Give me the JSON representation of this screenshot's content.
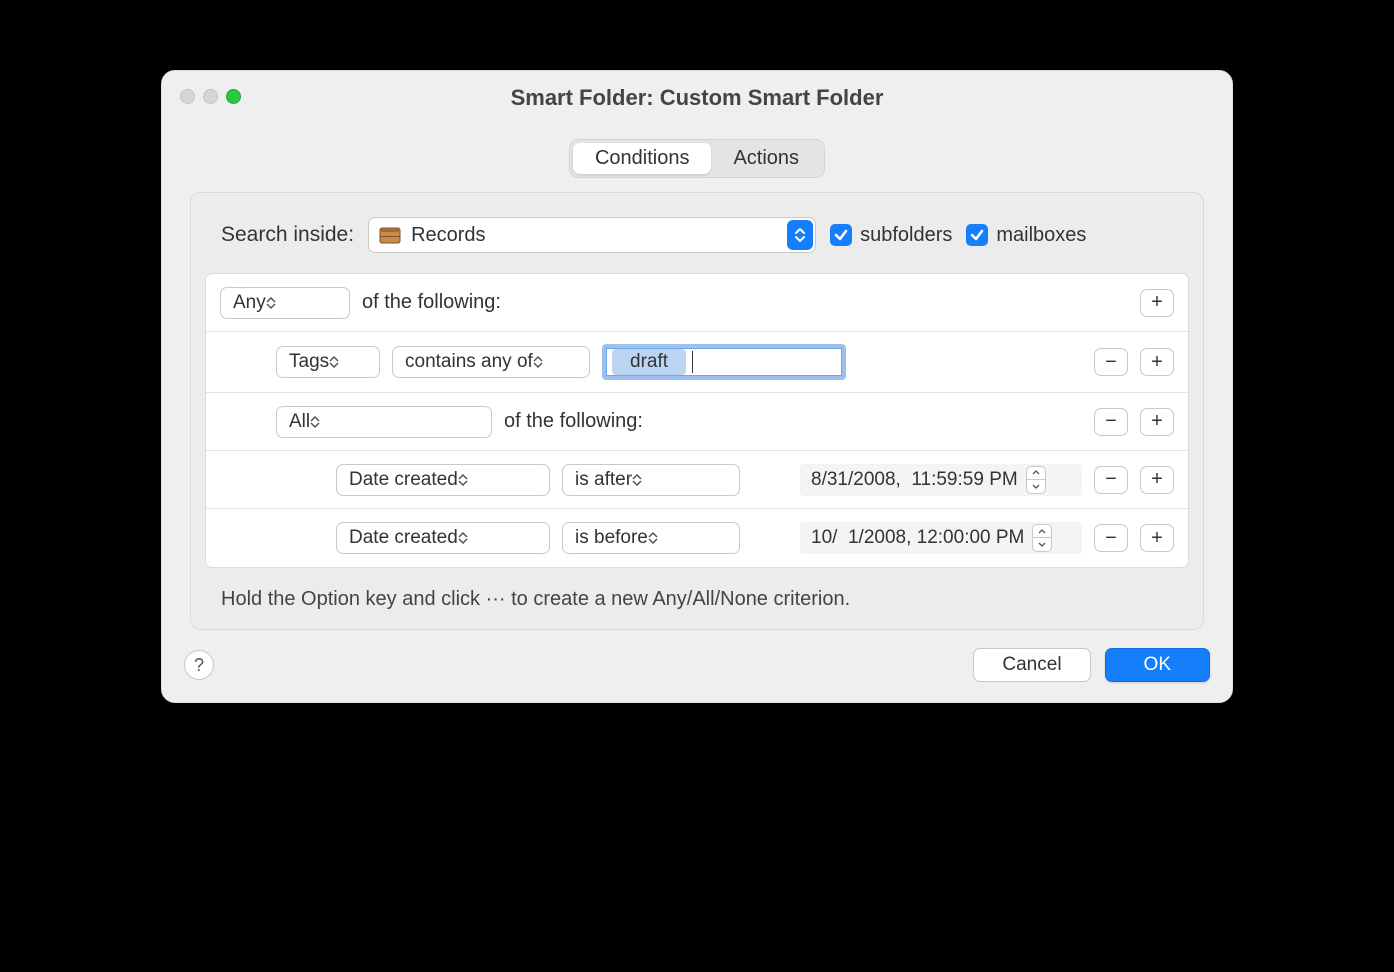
{
  "window": {
    "title": "Smart Folder: Custom Smart Folder"
  },
  "tabs": {
    "conditions": "Conditions",
    "actions": "Actions"
  },
  "search": {
    "label": "Search inside:",
    "folder": "Records",
    "subfolders_label": "subfolders",
    "mailboxes_label": "mailboxes"
  },
  "rules": {
    "row0": {
      "match": "Any",
      "suffix": "of the following:"
    },
    "row1": {
      "field": "Tags",
      "op": "contains any of",
      "token": "draft"
    },
    "row2": {
      "match": "All",
      "suffix": "of the following:"
    },
    "row3": {
      "field": "Date created",
      "op": "is after",
      "value": "8/31/2008,  11:59:59 PM"
    },
    "row4": {
      "field": "Date created",
      "op": "is before",
      "value": "10/  1/2008, 12:00:00 PM"
    }
  },
  "hint": "Hold the Option key and click ··· to create a new Any/All/None criterion.",
  "footer": {
    "cancel": "Cancel",
    "ok": "OK"
  }
}
